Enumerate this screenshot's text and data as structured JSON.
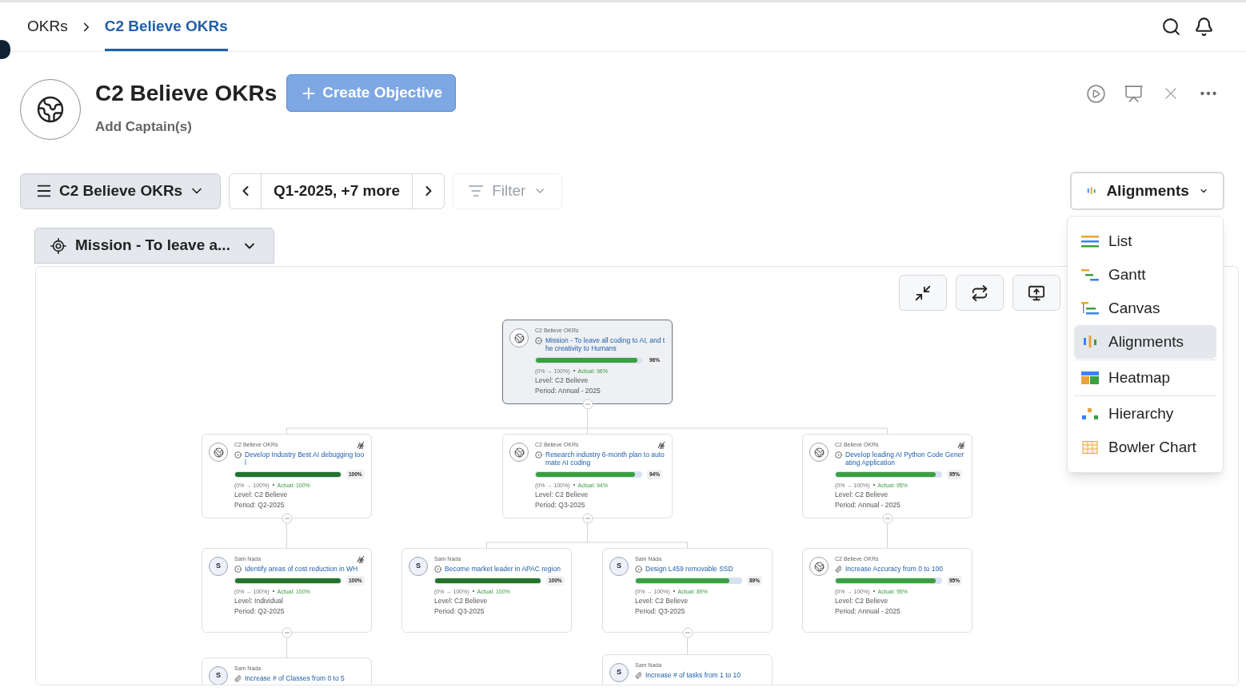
{
  "breadcrumb": [
    {
      "label": "OKRs",
      "selected": false
    },
    {
      "label": "C2 Believe OKRs",
      "selected": true
    }
  ],
  "header": {
    "title": "C2 Believe OKRs",
    "create_button": "Create Objective",
    "captains": "Add Captain(s)"
  },
  "toolbar": {
    "okr_select": "C2 Believe OKRs",
    "period": "Q1-2025, +7 more",
    "filter": {
      "label": "Filter",
      "disabled": true
    },
    "view_select": "Alignments"
  },
  "mission_select": "Mission - To leave a...",
  "view_menu": [
    {
      "label": "List",
      "kind": "list",
      "selected": false
    },
    {
      "label": "Gantt",
      "kind": "gantt",
      "selected": false
    },
    {
      "label": "Canvas",
      "kind": "canvas",
      "selected": false
    },
    {
      "label": "Alignments",
      "kind": "alignments",
      "selected": true
    },
    {
      "label": "Heatmap",
      "kind": "heatmap",
      "selected": false
    },
    {
      "label": "Hierarchy",
      "kind": "hierarchy",
      "selected": false
    },
    {
      "label": "Bowler Chart",
      "kind": "bowler",
      "selected": false
    }
  ],
  "tree": {
    "owner": "C2 Believe OKRs",
    "avatar": {
      "kind": "globe"
    },
    "kind": "objective",
    "title": "Mission - To leave all coding to AI, and the creativity to Humans",
    "level": 0.96,
    "percent": "96%",
    "color": "#3ba03f",
    "range": "(0% → 100%)",
    "actual": "Actual: 96%",
    "level_text": "Level: C2 Believe",
    "period": "Period: Annual - 2025",
    "aligned": false,
    "selected": true,
    "children": [
      {
        "owner": "C2 Believe OKRs",
        "avatar": {
          "kind": "globe"
        },
        "kind": "objective",
        "title": "Develop Industry Best AI debugging tool",
        "level": 1,
        "percent": "100%",
        "color": "#23742a",
        "range": "(0% → 100%)",
        "actual": "Actual: 100%",
        "level_text": "Level: C2 Believe",
        "period": "Period: Q2-2025",
        "aligned": true,
        "selected": false,
        "children": [
          {
            "owner": "Sam Nada",
            "avatar": {
              "kind": "initial",
              "text": "S"
            },
            "kind": "objective",
            "title": "Identify areas of cost reduction in WH",
            "level": 1,
            "percent": "100%",
            "color": "#23742a",
            "range": "(0% → 100%)",
            "actual": "Actual: 100%",
            "level_text": "Level: Individual",
            "period": "Period: Q2-2025",
            "aligned": true,
            "selected": false,
            "children": [
              {
                "owner": "Sam Nada",
                "avatar": {
                  "kind": "initial",
                  "text": "S"
                },
                "kind": "key_result",
                "title": "Increase # of Classes from 0 to 5",
                "aligned": false,
                "selected": false
              }
            ]
          }
        ]
      },
      {
        "owner": "C2 Believe OKRs",
        "avatar": {
          "kind": "globe"
        },
        "kind": "objective",
        "title": "Research industry 6-month plan to automate AI coding",
        "level": 0.94,
        "percent": "94%",
        "color": "#3ba03f",
        "range": "(0% → 100%)",
        "actual": "Actual: 94%",
        "level_text": "Level: C2 Believe",
        "period": "Period: Q3-2025",
        "aligned": true,
        "selected": false,
        "children": [
          {
            "owner": "Sam Nada",
            "avatar": {
              "kind": "initial",
              "text": "S"
            },
            "kind": "objective",
            "title": "Become market leader in APAC region",
            "level": 1,
            "percent": "100%",
            "color": "#23742a",
            "range": "(0% → 100%)",
            "actual": "Actual: 100%",
            "level_text": "Level: C2 Believe",
            "period": "Period: Q3-2025",
            "aligned": false,
            "selected": false
          },
          {
            "owner": "Sam Nada",
            "avatar": {
              "kind": "initial",
              "text": "S"
            },
            "kind": "objective",
            "title": "Design L459 removable SSD",
            "level": 0.89,
            "percent": "89%",
            "color": "#3ba03f",
            "range": "(0% → 100%)",
            "actual": "Actual: 89%",
            "level_text": "Level: C2 Believe",
            "period": "Period: Q3-2025",
            "aligned": false,
            "selected": false,
            "children": [
              {
                "owner": "Sam Nada",
                "avatar": {
                  "kind": "initial",
                  "text": "S"
                },
                "kind": "key_result",
                "title": "Increase # of tasks from 1 to 10",
                "aligned": false,
                "selected": false
              }
            ]
          }
        ]
      },
      {
        "owner": "C2 Believe OKRs",
        "avatar": {
          "kind": "globe"
        },
        "kind": "objective",
        "title": "Develop leading AI Python Code Generating Application",
        "level": 0.95,
        "percent": "95%",
        "color": "#3ba03f",
        "range": "(0% → 100%)",
        "actual": "Actual: 95%",
        "level_text": "Level: C2 Believe",
        "period": "Period: Annual - 2025",
        "aligned": true,
        "selected": false,
        "children": [
          {
            "owner": "C2 Believe OKRs",
            "avatar": {
              "kind": "globe"
            },
            "kind": "key_result",
            "title": "Increase Accuracy from 0 to 100",
            "level": 0.95,
            "percent": "95%",
            "color": "#3ba03f",
            "range": "(0% → 100%)",
            "actual": "Actual: 95%",
            "level_text": "Level: C2 Believe",
            "period": "Period: Annual - 2025",
            "aligned": false,
            "selected": false
          }
        ]
      }
    ]
  }
}
